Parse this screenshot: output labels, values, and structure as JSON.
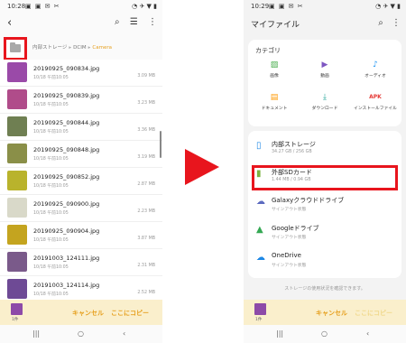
{
  "left": {
    "status_time": "10:28",
    "status_left_icons": "▣ ▣ ✉ ✂",
    "status_right_icons": "◔ ✈ ▼ ▮",
    "back_icon": "‹",
    "search_icon": "⌕",
    "list_icon": "☰",
    "more_icon": "⋮",
    "breadcrumb": {
      "root": "内部ストレージ",
      "sep": "▸",
      "mid": "DCIM",
      "current": "Camera"
    },
    "files": [
      {
        "name": "20190925_090834.jpg",
        "date": "10/18 午前10:05",
        "size": "3.09 MB",
        "color": "#9a4aa8"
      },
      {
        "name": "20190925_090839.jpg",
        "date": "10/18 午前10:05",
        "size": "3.23 MB",
        "color": "#b04c8a"
      },
      {
        "name": "20190925_090844.jpg",
        "date": "10/18 午前10:05",
        "size": "3.36 MB",
        "color": "#6f7f52"
      },
      {
        "name": "20190925_090848.jpg",
        "date": "10/18 午前10:05",
        "size": "3.19 MB",
        "color": "#8a8f48"
      },
      {
        "name": "20190925_090852.jpg",
        "date": "10/18 午前10:05",
        "size": "2.87 MB",
        "color": "#b9b32c"
      },
      {
        "name": "20190925_090900.jpg",
        "date": "10/18 午前10:05",
        "size": "2.23 MB",
        "color": "#d9d9c9"
      },
      {
        "name": "20190925_090904.jpg",
        "date": "10/18 午前10:05",
        "size": "3.87 MB",
        "color": "#c4a41f"
      },
      {
        "name": "20191003_124111.jpg",
        "date": "10/18 午前10:05",
        "size": "2.31 MB",
        "color": "#7a5a8a"
      },
      {
        "name": "20191003_124114.jpg",
        "date": "10/18 午前10:05",
        "size": "2.52 MB",
        "color": "#6e4a95"
      }
    ],
    "selected_count": "1件",
    "cancel_label": "キャンセル",
    "copy_label": "ここにコピー",
    "nav_recent": "|||",
    "nav_home": "○",
    "nav_back": "‹"
  },
  "right": {
    "status_time": "10:29",
    "title": "マイファイル",
    "category_title": "カテゴリ",
    "categories": [
      {
        "label": "画像",
        "icon": "▨",
        "color": "#4caf50"
      },
      {
        "label": "動画",
        "icon": "▶",
        "color": "#7e57c2"
      },
      {
        "label": "オーディオ",
        "icon": "♪",
        "color": "#2196f3"
      },
      {
        "label": "ドキュメント",
        "icon": "▤",
        "color": "#ff9800"
      },
      {
        "label": "ダウンロード",
        "icon": "⤓",
        "color": "#26a69a"
      },
      {
        "label": "インストールファイル",
        "icon": "APK",
        "color": "#e53935"
      }
    ],
    "storages": [
      {
        "name": "内部ストレージ",
        "sub": "34.27 GB / 256 GB",
        "icon": "▯",
        "color": "#1e88e5"
      },
      {
        "name": "外部SDカード",
        "sub": "1.44 MB / 0.94 GB",
        "icon": "▮",
        "color": "#7cb342"
      },
      {
        "name": "Galaxyクラウドドライブ",
        "sub": "サインアウト状態",
        "icon": "☁",
        "color": "#5c6bc0"
      },
      {
        "name": "Googleドライブ",
        "sub": "サインアウト状態",
        "icon": "▲",
        "color": "#34a853"
      },
      {
        "name": "OneDrive",
        "sub": "サインアウト状態",
        "icon": "☁",
        "color": "#1e88e5"
      }
    ],
    "hint": "ストレージの使用状況を確認できます。"
  },
  "colors": {
    "accent": "#e6a01f",
    "highlight": "#e8151d"
  }
}
